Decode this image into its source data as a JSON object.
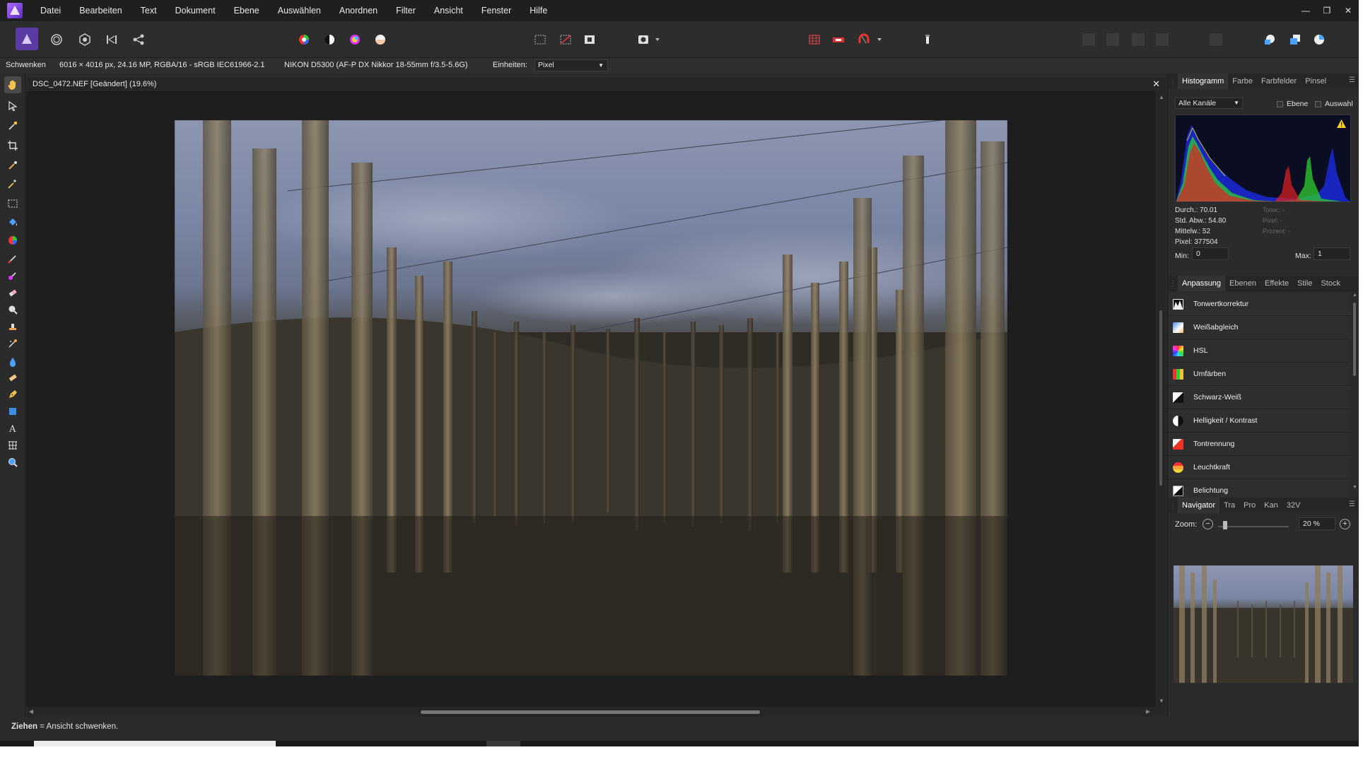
{
  "menubar": {
    "items": [
      "Datei",
      "Bearbeiten",
      "Text",
      "Dokument",
      "Ebene",
      "Auswählen",
      "Anordnen",
      "Filter",
      "Ansicht",
      "Fenster",
      "Hilfe"
    ]
  },
  "context": {
    "tool_name": "Schwenken",
    "doc_info": "6016 × 4016 px, 24.16 MP, RGBA/16 - sRGB IEC61966-2.1",
    "camera": "NIKON D5300 (AF-P DX Nikkor 18-55mm f/3.5-5.6G)",
    "units_label": "Einheiten:",
    "units_value": "Pixel"
  },
  "document": {
    "tab_title": "DSC_0472.NEF [Geändert] (19.6%)"
  },
  "histogram_panel": {
    "tabs": [
      "Histogramm",
      "Farbe",
      "Farbfelder",
      "Pinsel"
    ],
    "channel": "Alle Kanäle",
    "check_layer": "Ebene",
    "check_selection": "Auswahl",
    "stats": [
      "Durch.: 70.01",
      "Std. Abw.: 54.80",
      "Mittelw.: 52",
      "Pixel: 377504"
    ],
    "stats_dim": [
      "Tonw.: -",
      "Pixel: -",
      "Prozent: -"
    ],
    "min_label": "Min:",
    "min_value": "0",
    "max_label": "Max:",
    "max_value": "1"
  },
  "adjustment_panel": {
    "tabs": [
      "Anpassung",
      "Ebenen",
      "Effekte",
      "Stile",
      "Stock"
    ],
    "items": [
      {
        "label": "Tonwertkorrektur"
      },
      {
        "label": "Weißabgleich"
      },
      {
        "label": "HSL"
      },
      {
        "label": "Umfärben"
      },
      {
        "label": "Schwarz-Weiß"
      },
      {
        "label": "Helligkeit / Kontrast"
      },
      {
        "label": "Tontrennung"
      },
      {
        "label": "Leuchtkraft"
      },
      {
        "label": "Belichtung"
      }
    ]
  },
  "navigator_panel": {
    "tabs": [
      "Navigator",
      "Tra",
      "Pro",
      "Kan",
      "32V"
    ],
    "zoom_label": "Zoom:",
    "zoom_value": "20 %"
  },
  "status": {
    "bold": "Ziehen",
    "rest": " = Ansicht schwenken."
  },
  "colors": {
    "app_bg": "#2b2b2b",
    "accent": "#8a5cf6"
  }
}
